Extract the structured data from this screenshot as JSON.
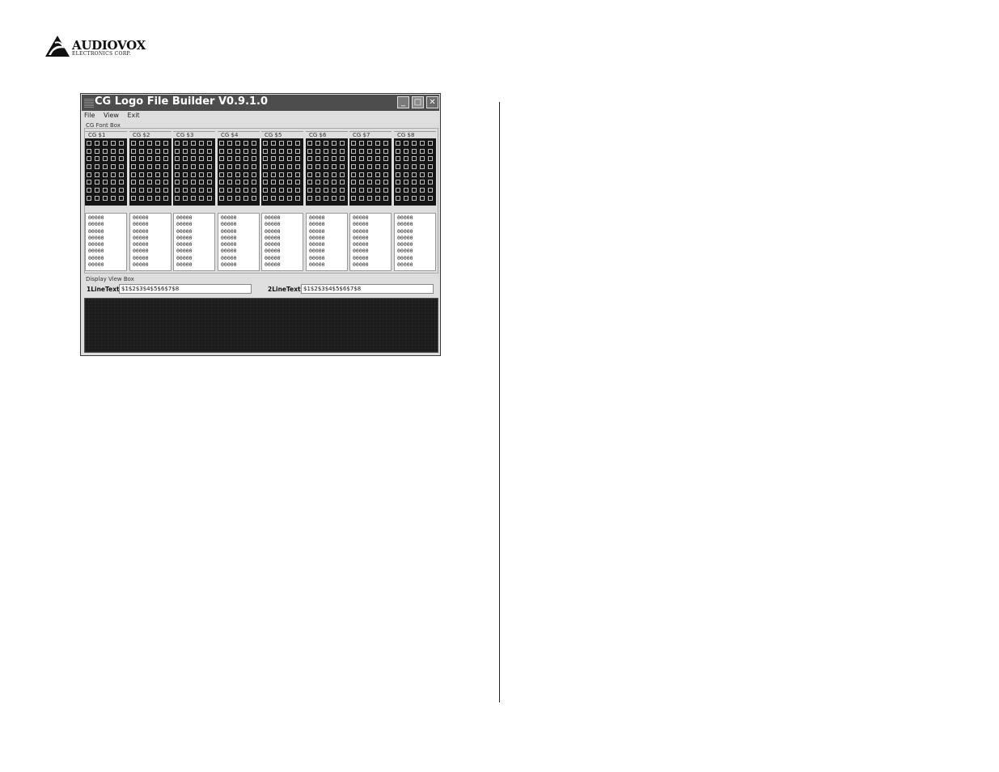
{
  "logo": {
    "brand": "AUDIOVOX",
    "sub": "ELECTRONICS CORP."
  },
  "window": {
    "title": "CG Logo File Builder V0.9.1.0",
    "min_glyph": "_",
    "max_glyph": "□",
    "close_glyph": "✕"
  },
  "menu": {
    "file": "File",
    "view": "View",
    "exit": "Exit"
  },
  "font_box": {
    "label": "CG Font Box",
    "columns": [
      {
        "label": "CG $1",
        "text": "00000\n00000\n00000\n00000\n00000\n00000\n00000\n00000"
      },
      {
        "label": "CG $2",
        "text": "00000\n00000\n00000\n00000\n00000\n00000\n00000\n00000"
      },
      {
        "label": "CG $3",
        "text": "00000\n00000\n00000\n00000\n00000\n00000\n00000\n00000"
      },
      {
        "label": "CG $4",
        "text": "00000\n00000\n00000\n00000\n00000\n00000\n00000\n00000"
      },
      {
        "label": "CG $5",
        "text": "00000\n00000\n00000\n00000\n00000\n00000\n00000\n00000"
      },
      {
        "label": "CG $6",
        "text": "00000\n00000\n00000\n00000\n00000\n00000\n00000\n00000"
      },
      {
        "label": "CG $7",
        "text": "00000\n00000\n00000\n00000\n00000\n00000\n00000\n00000"
      },
      {
        "label": "CG $8",
        "text": "00000\n00000\n00000\n00000\n00000\n00000\n00000\n00000"
      }
    ]
  },
  "display_box": {
    "label": "Display View Box",
    "line1_label": "1LineText",
    "line1_value": "$1$2$3$4$5$6$7$8",
    "line2_label": "2LineText",
    "line2_value": "$1$2$3$4$5$6$7$8"
  }
}
